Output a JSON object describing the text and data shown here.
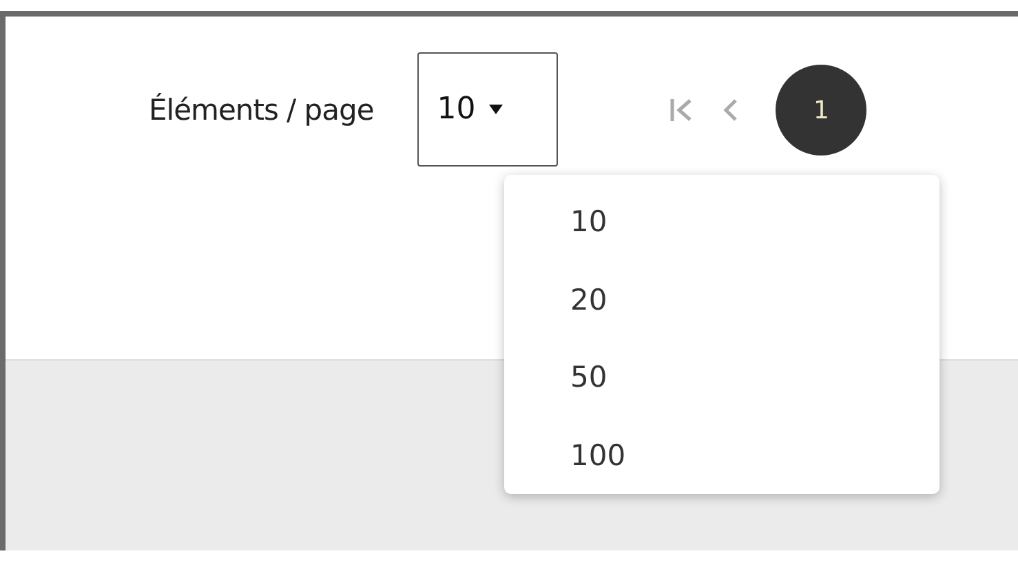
{
  "pagination": {
    "label": "Éléments / page",
    "page_size": "10",
    "current_page": "1"
  },
  "page_size_menu": {
    "options": [
      "10",
      "20",
      "50",
      "100"
    ]
  }
}
